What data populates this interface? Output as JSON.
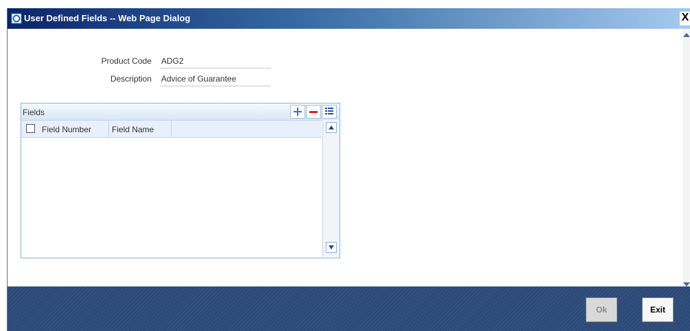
{
  "window": {
    "title": "User Defined Fields -- Web Page Dialog",
    "close_glyph": "X"
  },
  "form": {
    "product_code_label": "Product Code",
    "product_code_value": "ADG2",
    "description_label": "Description",
    "description_value": "Advice of Guarantee"
  },
  "fields_table": {
    "title": "Fields",
    "columns": [
      "Field Number",
      "Field Name"
    ],
    "rows": [],
    "icons": [
      "add-row-icon",
      "delete-row-icon",
      "single-view-icon"
    ]
  },
  "footer": {
    "ok_label": "Ok",
    "exit_label": "Exit",
    "ok_enabled": false
  },
  "colors": {
    "title_start": "#0a246a",
    "title_end": "#a6caf0",
    "footer": "#2c4a78"
  }
}
